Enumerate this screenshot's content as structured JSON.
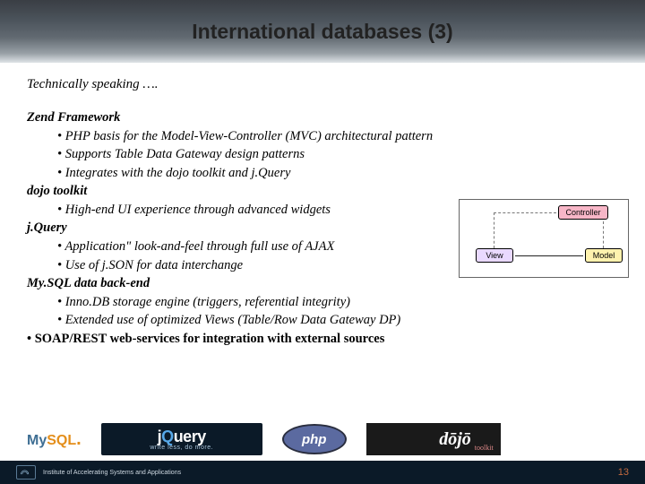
{
  "title": "International databases (3)",
  "lead": "Technically speaking ….",
  "sections": {
    "zend": {
      "heading": "Zend Framework",
      "items": [
        "PHP basis for the Model-View-Controller (MVC) architectural pattern",
        "Supports Table Data Gateway design patterns",
        "Integrates with the dojo toolkit and j.Query"
      ]
    },
    "dojo": {
      "heading": "dojo toolkit",
      "items": [
        "High-end UI experience through advanced widgets"
      ]
    },
    "jquery": {
      "heading": "j.Query",
      "items": [
        "Application\" look-and-feel through full use of AJAX",
        "Use of j.SON for data interchange"
      ]
    },
    "mysql": {
      "heading": "My.SQL data back-end",
      "items": [
        "Inno.DB storage engine (triggers, referential integrity)",
        "Extended use of optimized Views (Table/Row Data Gateway DP)"
      ]
    },
    "soap": "SOAP/REST web-services for integration with external sources"
  },
  "mvc": {
    "controller": "Controller",
    "view": "View",
    "model": "Model"
  },
  "logos": {
    "mysql_my": "My",
    "mysql_sql": "SQL",
    "jquery_big_j": "j",
    "jquery_big_q": "Q",
    "jquery_big_rest": "uery",
    "jquery_small": "write less, do more.",
    "php": "php",
    "dojo": "dōjō",
    "dojo_tk": "toolkit"
  },
  "footer": {
    "org": "Institute of Accelerating Systems and Applications",
    "page": "13"
  }
}
